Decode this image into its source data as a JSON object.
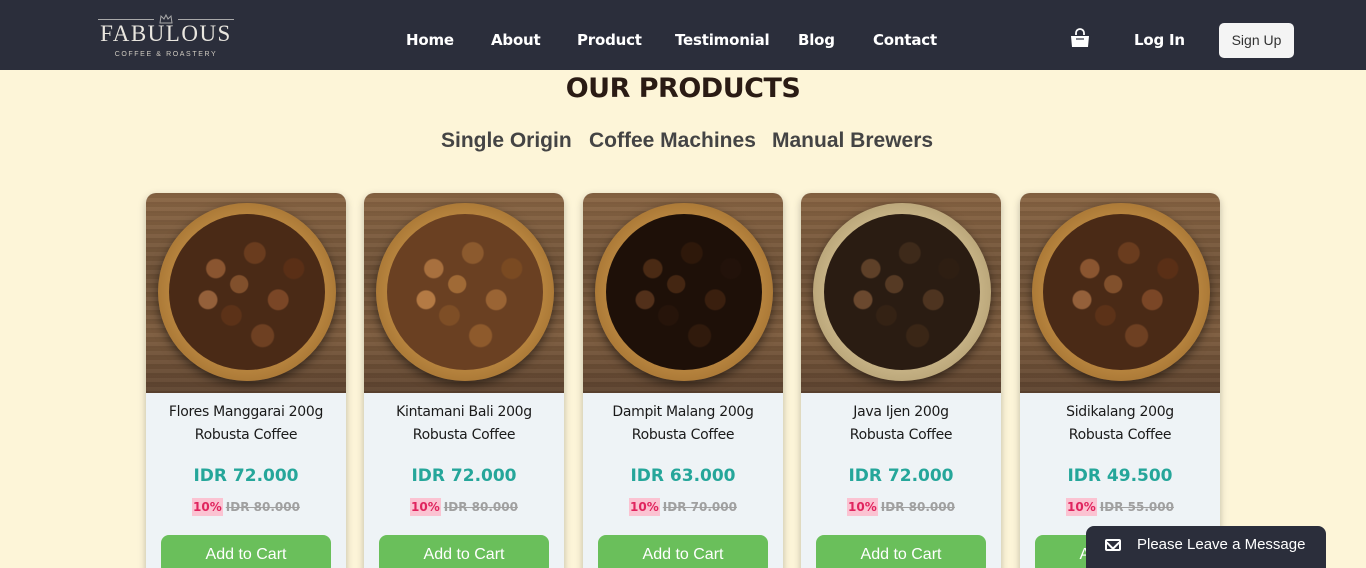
{
  "brand": {
    "name": "FABULOUS",
    "tagline": "COFFEE & ROASTERY"
  },
  "nav": {
    "items": [
      {
        "label": "Home"
      },
      {
        "label": "About"
      },
      {
        "label": "Product"
      },
      {
        "label": "Testimonial"
      },
      {
        "label": "Blog"
      },
      {
        "label": "Contact"
      }
    ],
    "cart_icon": "shopping-bag-icon",
    "login_label": "Log In",
    "signup_label": "Sign Up"
  },
  "section": {
    "title": "OUR PRODUCTS",
    "tabs": [
      {
        "label": "Single Origin"
      },
      {
        "label": "Coffee Machines"
      },
      {
        "label": "Manual Brewers"
      }
    ]
  },
  "products": [
    {
      "name_line1": "Flores Manggarai 200g",
      "name_line2": "Robusta Coffee",
      "price": "IDR 72.000",
      "discount": "10%",
      "old_price": "IDR 80.000",
      "button": "Add to Cart"
    },
    {
      "name_line1": "Kintamani Bali 200g",
      "name_line2": "Robusta Coffee",
      "price": "IDR 72.000",
      "discount": "10%",
      "old_price": "IDR 80.000",
      "button": "Add to Cart"
    },
    {
      "name_line1": "Dampit Malang 200g",
      "name_line2": "Robusta Coffee",
      "price": "IDR 63.000",
      "discount": "10%",
      "old_price": "IDR 70.000",
      "button": "Add to Cart"
    },
    {
      "name_line1": "Java Ijen 200g",
      "name_line2": "Robusta Coffee",
      "price": "IDR 72.000",
      "discount": "10%",
      "old_price": "IDR 80.000",
      "button": "Add to Cart"
    },
    {
      "name_line1": "Sidikalang 200g",
      "name_line2": "Robusta Coffee",
      "price": "IDR 49.500",
      "discount": "10%",
      "old_price": "IDR 55.000",
      "button": "Add to Cart"
    }
  ],
  "chat": {
    "label": "Please Leave a Message",
    "icon": "envelope-icon"
  },
  "colors": {
    "nav_bg": "#2b2e3b",
    "page_bg": "#fdf5d8",
    "price": "#25a69a",
    "discount_text": "#e0245e",
    "discount_bg": "#fbc3d2",
    "button": "#6abf5b"
  }
}
